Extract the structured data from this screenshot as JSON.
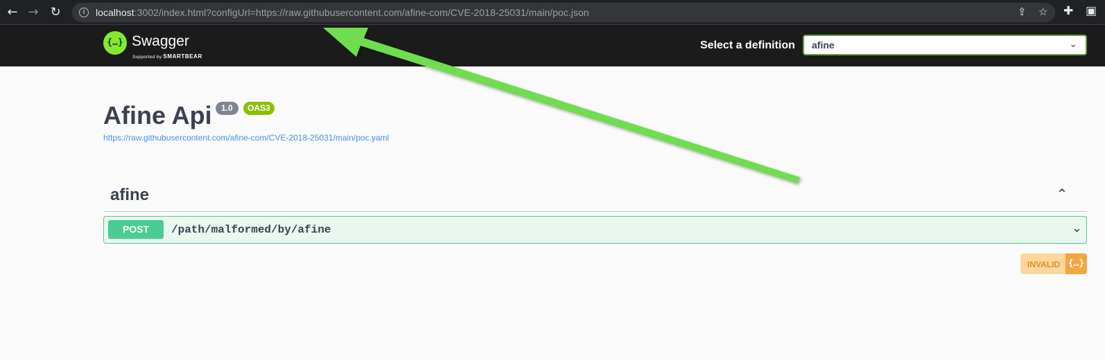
{
  "browser": {
    "back_icon": "←",
    "forward_icon": "→",
    "reload_icon": "↻",
    "info_icon": "i",
    "url_host": "localhost",
    "url_rest": ":3002/index.html?configUrl=https://raw.githubusercontent.com/afine-com/CVE-2018-25031/main/poc.json",
    "share_icon": "⇪",
    "star_icon": "☆",
    "extensions_icon": "✚",
    "sidepanel_icon": "▣"
  },
  "topbar": {
    "logo_glyph": "{…}",
    "logo_text": "Swagger",
    "logo_sub_prefix": "Supported by",
    "logo_sub_brand": "SMARTBEAR",
    "select_label": "Select a definition",
    "select_value": "afine",
    "select_chevron": "⌄"
  },
  "info": {
    "title": "Afine Api",
    "version": "1.0",
    "oas": "OAS3",
    "spec_url": "https://raw.githubusercontent.com/afine-com/CVE-2018-25031/main/poc.yaml"
  },
  "tag": {
    "name": "afine",
    "chevron": "⌃"
  },
  "operation": {
    "method": "POST",
    "path": "/path/malformed/by/afine",
    "chevron": "⌄"
  },
  "validator": {
    "label": "INVALID",
    "icon": "{…}"
  },
  "colors": {
    "annotation_arrow": "#6fdc4f",
    "post_method": "#49cc90",
    "swagger_green": "#85ea2d",
    "invalid_orange": "#f4a641"
  }
}
